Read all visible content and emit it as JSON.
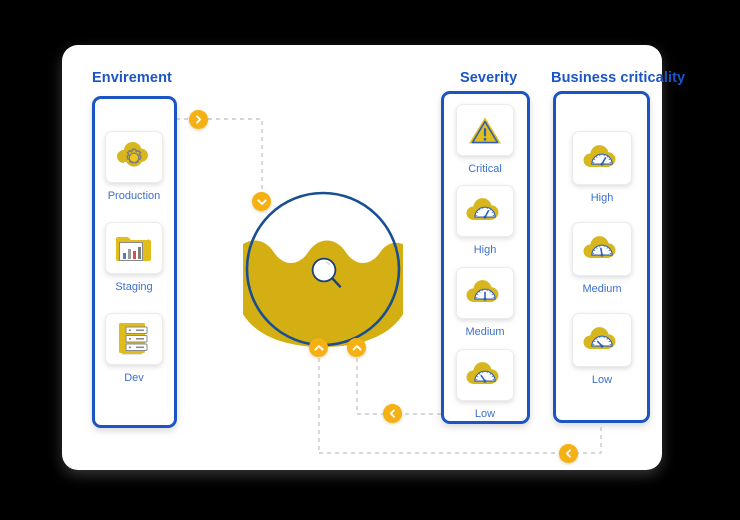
{
  "diagram": {
    "title_color": "#1B55C4",
    "accent_yellow": "#D4AF13",
    "badge_orange": "#F5B113",
    "label_color": "#3c6fd0",
    "wire_color": "#c9c9c9"
  },
  "groups": [
    {
      "id": "envirement",
      "title": "Envirement",
      "items": [
        {
          "label": "Production",
          "icon": "cloud-gear-icon"
        },
        {
          "label": "Staging",
          "icon": "folder-chart-icon"
        },
        {
          "label": "Dev",
          "icon": "server-rack-icon"
        }
      ]
    },
    {
      "id": "severity",
      "title": "Severity",
      "items": [
        {
          "label": "Critical",
          "icon": "warning-triangle-icon"
        },
        {
          "label": "High",
          "icon": "cloud-gauge-icon"
        },
        {
          "label": "Medium",
          "icon": "cloud-gauge-icon"
        },
        {
          "label": "Low",
          "icon": "cloud-gauge-icon"
        }
      ]
    },
    {
      "id": "business-criticality",
      "title": "Business criticality",
      "items": [
        {
          "label": "High",
          "icon": "cloud-gauge-icon"
        },
        {
          "label": "Medium",
          "icon": "cloud-gauge-icon"
        },
        {
          "label": "Low",
          "icon": "cloud-gauge-icon"
        }
      ]
    }
  ],
  "center": {
    "name": "scan-bubble",
    "icon": "magnifier-icon",
    "fill_label": "liquid-fill"
  },
  "connectors": [
    {
      "id": "c1",
      "icon": "chevron-right-icon",
      "direction": "right"
    },
    {
      "id": "c2",
      "icon": "chevron-down-icon",
      "direction": "down"
    },
    {
      "id": "c3",
      "icon": "chevron-up-icon",
      "direction": "up"
    },
    {
      "id": "c4",
      "icon": "chevron-up-icon",
      "direction": "up"
    },
    {
      "id": "c5",
      "icon": "chevron-left-icon",
      "direction": "left"
    },
    {
      "id": "c6",
      "icon": "chevron-left-icon",
      "direction": "left"
    }
  ]
}
